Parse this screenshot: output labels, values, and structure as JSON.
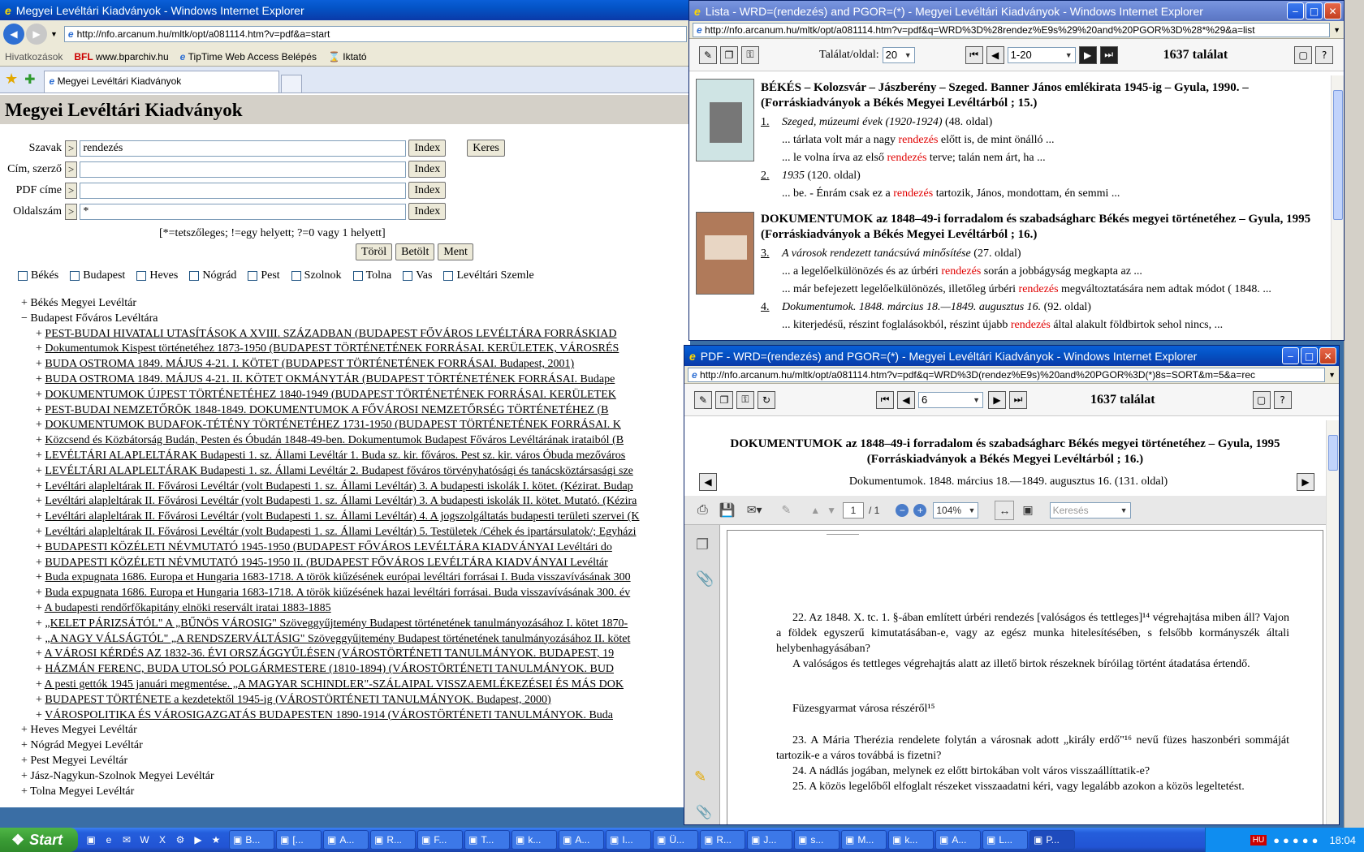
{
  "main": {
    "title": "Megyei Levéltári Kiadványok - Windows Internet Explorer",
    "url": "http://nfo.arcanum.hu/mltk/opt/a081114.htm?v=pdf&a=start",
    "fav_label": "Hivatkozások",
    "favs": [
      "www.bparchiv.hu",
      "TipTime Web Access Belépés",
      "Iktató"
    ],
    "tab_label": "Megyei Levéltári Kiadványok",
    "page_heading": "Megyei Levéltári Kiadványok",
    "form": {
      "rows": [
        {
          "label": "Szavak",
          "value": "rendezés"
        },
        {
          "label": "Cím, szerző",
          "value": ""
        },
        {
          "label": "PDF címe",
          "value": ""
        },
        {
          "label": "Oldalszám",
          "value": "*"
        }
      ],
      "op": ">",
      "index_label": "Index",
      "search_label": "Keres",
      "hint": "[*=tetszőleges; !=egy helyett; ?=0 vagy 1 helyett]",
      "clear_label": "Töröl",
      "load_label": "Betölt",
      "save_label": "Ment"
    },
    "checkboxes": [
      "Békés",
      "Budapest",
      "Heves",
      "Nógrád",
      "Pest",
      "Szolnok",
      "Tolna",
      "Vas",
      "Levéltári Szemle"
    ],
    "tree": {
      "top_before": [
        {
          "sign": "+",
          "label": "Békés Megyei Levéltár"
        }
      ],
      "expanded": {
        "sign": "−",
        "label": "Budapest Főváros Levéltára"
      },
      "children": [
        "PEST-BUDAI HIVATALI UTASÍTÁSOK A XVIII. SZÁZADBAN (BUDAPEST FŐVÁROS LEVÉLTÁRA FORRÁSKIAD",
        "Dokumentumok Kispest történetéhez 1873-1950 (BUDAPEST TÖRTÉNETÉNEK FORRÁSAI. KERÜLETEK, VÁROSRÉS",
        "BUDA OSTROMA 1849. MÁJUS 4-21. I. KÖTET (BUDAPEST TÖRTÉNETÉNEK FORRÁSAI. Budapest, 2001)",
        "BUDA OSTROMA 1849. MÁJUS 4-21. II. KÖTET OKMÁNYTÁR (BUDAPEST TÖRTÉNETÉNEK FORRÁSAI. Budape",
        "DOKUMENTUMOK ÚJPEST TÖRTÉNETÉHEZ 1840-1949 (BUDAPEST TÖRTÉNETÉNEK FORRÁSAI. KERÜLETEK",
        "PEST-BUDAI NEMZETŐRÖK 1848-1849. DOKUMENTUMOK A FŐVÁROSI NEMZETŐRSÉG TÖRTÉNETÉHEZ (B",
        "DOKUMENTUMOK BUDAFOK-TÉTÉNY TÖRTÉNETÉHEZ 1731-1950 (BUDAPEST TÖRTÉNETÉNEK FORRÁSAI. K",
        "Közcsend és Közbátorság Budán, Pesten és Óbudán 1848-49-ben. Dokumentumok Budapest Főváros Levéltárának irataiból (B",
        "LEVÉLTÁRI ALAPLELTÁRAK Budapesti 1. sz. Állami Levéltár 1. Buda sz. kir. főváros. Pest sz. kir. város Óbuda mezőváros",
        "LEVÉLTÁRI ALAPLELTÁRAK Budapesti 1. sz. Állami Levéltár 2. Budapest főváros törvényhatósági és tanácsköztársasági sze",
        "Levéltári alapleltárak II. Fővárosi Levéltár (volt Budapesti 1. sz. Állami Levéltár) 3. A budapesti iskolák I. kötet. (Kézirat. Budap",
        "Levéltári alapleltárak II. Fővárosi Levéltár (volt Budapesti 1. sz. Állami Levéltár) 3. A budapesti iskolák II. kötet. Mutató. (Kézira",
        "Levéltári alapleltárak II. Fővárosi Levéltár (volt Budapesti 1. sz. Állami Levéltár) 4. A jogszolgáltatás budapesti területi szervei (K",
        "Levéltári alapleltárak II. Fővárosi Levéltár (volt Budapesti 1. sz. Állami Levéltár) 5. Testületek /Céhek és ipartársulatok/; Egyházi",
        "BUDAPESTI KÖZÉLETI NÉVMUTATÓ 1945-1950 (BUDAPEST FŐVÁROS LEVÉLTÁRA KIADVÁNYAI Levéltári do",
        "BUDAPESTI KÖZÉLETI NÉVMUTATÓ 1945-1950 II. (BUDAPEST FŐVÁROS LEVÉLTÁRA KIADVÁNYAI Levéltár",
        "Buda expugnata 1686. Europa et Hungaria 1683-1718. A török kiűzésének európai levéltári forrásai I. Buda visszavívásának 300",
        "Buda expugnata 1686. Europa et Hungaria 1683-1718. A török kiűzésének hazai levéltári forrásai. Buda visszavívásának 300. év",
        "A budapesti rendőrfőkapitány elnöki reservált iratai 1883-1885",
        "„KELET PÁRIZSÁTÓL\" A „BŰNÖS VÁROSIG\" Szöveggyűjtemény Budapest történetének tanulmányozásához I. kötet 1870-",
        "„A NAGY VÁLSÁGTÓL\" „A RENDSZERVÁLTÁSIG\" Szöveggyűjtemény Budapest történetének tanulmányozásához II. kötet",
        "A VÁROSI KÉRDÉS AZ 1832-36. ÉVI ORSZÁGGYŰLÉSEN (VÁROSTÖRTÉNETI TANULMÁNYOK. BUDAPEST, 19",
        "HÁZMÁN FERENC, BUDA UTOLSÓ POLGÁRMESTERE (1810-1894) (VÁROSTÖRTÉNETI TANULMÁNYOK. BUD",
        "A pesti gettók 1945 januári megmentése. „A MAGYAR SCHINDLER\"-SZÁLAIPAL VISSZAEMLÉKEZÉSEI ÉS MÁS DOK",
        "BUDAPEST TÖRTÉNETE a kezdetektől 1945-ig (VÁROSTÖRTÉNETI TANULMÁNYOK. Budapest, 2000)",
        "VÁROSPOLITIKA ÉS VÁROSIGAZGATÁS BUDAPESTEN 1890-1914 (VÁROSTÖRTÉNETI TANULMÁNYOK. Buda"
      ],
      "top_after": [
        {
          "sign": "+",
          "label": "Heves Megyei Levéltár"
        },
        {
          "sign": "+",
          "label": "Nógrád Megyei Levéltár"
        },
        {
          "sign": "+",
          "label": "Pest Megyei Levéltár"
        },
        {
          "sign": "+",
          "label": "Jász-Nagykun-Szolnok Megyei Levéltár"
        },
        {
          "sign": "+",
          "label": "Tolna Megyei Levéltár"
        }
      ]
    }
  },
  "lista": {
    "title": "Lista - WRD=(rendezés) and PGOR=(*) - Megyei Levéltári Kiadványok - Windows Internet Explorer",
    "url": "http://nfo.arcanum.hu/mltk/opt/a081114.htm?v=pdf&q=WRD%3D%28rendez%E9s%29%20and%20PGOR%3D%28*%29&a=list",
    "per_page_label": "Találat/oldal:",
    "per_page": "20",
    "range": "1-20",
    "count": "1637 találat",
    "book1": {
      "title": "BÉKÉS – Kolozsvár – Jászberény – Szeged. Banner János emlékirata 1945-ig – Gyula, 1990. – (Forráskiadványok a Békés Megyei Levéltárból ; 15.)",
      "hits": [
        {
          "num": "1.",
          "title": "Szeged, múzeumi évek (1920-1924)",
          "page": "(48. oldal)",
          "snippets": [
            {
              "pre": "... tárlata volt már a nagy ",
              "hl": "rendezés",
              "post": " előtt is, de mint önálló ..."
            },
            {
              "pre": "... le volna írva az első ",
              "hl": "rendezés",
              "post": " terve; talán nem árt, ha ..."
            }
          ]
        },
        {
          "num": "2.",
          "title": "1935",
          "page": "(120. oldal)",
          "snippets": [
            {
              "pre": "... be. - Énrám csak ez a ",
              "hl": "rendezés",
              "post": " tartozik, János, mondottam, én semmi ..."
            }
          ]
        }
      ]
    },
    "book2": {
      "title": "DOKUMENTUMOK az 1848–49-i forradalom és szabadságharc Békés megyei történetéhez – Gyula, 1995 (Forráskiadványok a Békés Megyei Levéltárból ; 16.)",
      "hits": [
        {
          "num": "3.",
          "title": "A városok rendezett tanácsúvá minősítése",
          "page": "(27. oldal)",
          "snippets": [
            {
              "pre": "... a legelőelkülönözés és az úrbéri ",
              "hl": "rendezés",
              "post": " során a jobbágyság megkapta az ..."
            },
            {
              "pre": "... már befejezett legelőelkülönözés, illetőleg úrbéri ",
              "hl": "rendezés",
              "post": " megváltoztatására nem adtak módot ( 1848. ..."
            }
          ]
        },
        {
          "num": "4.",
          "title": "Dokumentumok. 1848. március 18.—1849. augusztus 16.",
          "page": "(92. oldal)",
          "snippets": [
            {
              "pre": "... kiterjedésű, részint foglalásokból, részint újabb ",
              "hl": "rendezés",
              "post": " által alakult földbirtok sehol nincs, ..."
            }
          ]
        }
      ]
    }
  },
  "pdf": {
    "title": "PDF - WRD=(rendezés) and PGOR=(*) - Megyei Levéltári Kiadványok - Windows Internet Explorer",
    "url": "http://nfo.arcanum.hu/mltk/opt/a081114.htm?v=pdf&q=WRD%3D(rendez%E9s)%20and%20PGOR%3D(*)8s=SORT&m=5&a=rec",
    "record": "6",
    "count": "1637 találat",
    "book_title": "DOKUMENTUMOK az 1848–49-i forradalom és szabadságharc Békés megyei történetéhez – Gyula, 1995 (Forráskiadványok a Békés Megyei Levéltárból ; 16.)",
    "chapter": "Dokumentumok. 1848. március 18.—1849. augusztus 16. (131. oldal)",
    "reader": {
      "page": "1",
      "page_total": "/ 1",
      "zoom": "104%",
      "search_placeholder": "Keresés"
    },
    "doc": {
      "p1": "22. Az 1848. X. tc. 1. §-ában említett úrbéri rendezés [valóságos és tettleges]¹⁴ végrehajtása miben áll? Vajon a földek egyszerű kimutatásában-e, vagy az egész munka hitelesítésében, s felsőbb kormányszék általi helybenhagyásában?",
      "p2": "A valóságos és tettleges végrehajtás alatt az illető birtok részeknek bíróilag történt átadatása értendő.",
      "p3": "Füzesgyarmat városa részéről¹⁵",
      "p4": "23. A Mária Therézia rendelete folytán a városnak adott „király erdő\"¹⁶ nevű füzes haszonbéri sommáját tartozik-e a város továbbá is fizetni?",
      "p5": "24. A nádlás jogában, melynek ez előtt birtokában volt város visszaállíttatik-e?",
      "p6": "25. A közös legelőből elfoglalt részeket visszaadatni kéri, vagy legalább azokon a közös legeltetést."
    }
  },
  "taskbar": {
    "start": "Start",
    "tasks": [
      "B...",
      "[...",
      "A...",
      "R...",
      "F...",
      "T...",
      "k...",
      "A...",
      "I...",
      "Ü...",
      "R...",
      "J...",
      "s...",
      "M...",
      "k...",
      "A...",
      "L...",
      "P..."
    ],
    "clock": "18:04",
    "tray_badge": "HU"
  },
  "colors": {
    "highlight": "#e00000",
    "titlebar": "#0453c5"
  }
}
